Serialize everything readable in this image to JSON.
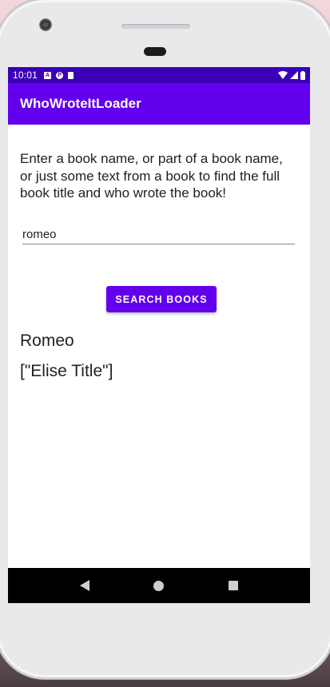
{
  "status_bar": {
    "time": "10:01",
    "left_icons": [
      "a-icon",
      "p-icon",
      "sd-card-icon"
    ],
    "right_icons": [
      "wifi-icon",
      "signal-icon",
      "battery-icon"
    ]
  },
  "app_bar": {
    "title": "WhoWroteItLoader"
  },
  "main": {
    "instructions": "Enter a book name, or part of a book name, or just some text from a book to find the full book title and who wrote the book!",
    "search_input": {
      "value": "romeo",
      "placeholder": ""
    },
    "search_button_label": "SEARCH BOOKS",
    "result_title": "Romeo",
    "result_author": "[\"Elise Title\"]"
  },
  "nav_bar": {
    "icons": [
      "back-icon",
      "home-icon",
      "recents-icon"
    ]
  },
  "colors": {
    "primary": "#6200ee",
    "primary_dark": "#3a00b8",
    "nav_bar": "#000000"
  }
}
